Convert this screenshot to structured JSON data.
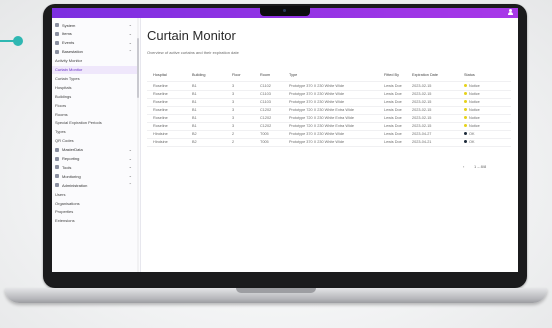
{
  "topbar": {
    "accent_start": "#7c2fe0",
    "accent_end": "#a838e8",
    "user_icon": "user-icon",
    "label": "ai"
  },
  "sidebar": {
    "items": [
      {
        "label": "System",
        "type": "group",
        "expanded": false
      },
      {
        "label": "Items",
        "type": "group",
        "expanded": false
      },
      {
        "label": "Events",
        "type": "group",
        "expanded": false
      },
      {
        "label": "Basestation",
        "type": "group",
        "expanded": true
      },
      {
        "label": "Activity Monitor",
        "type": "sub"
      },
      {
        "label": "Curtain Monitor",
        "type": "sub",
        "active": true
      },
      {
        "label": "Curtain Types",
        "type": "sub"
      },
      {
        "label": "Hospitals",
        "type": "sub"
      },
      {
        "label": "Buildings",
        "type": "sub"
      },
      {
        "label": "Floors",
        "type": "sub"
      },
      {
        "label": "Rooms",
        "type": "sub"
      },
      {
        "label": "Special Expiration Periods",
        "type": "sub"
      },
      {
        "label": "Types",
        "type": "sub"
      },
      {
        "label": "QR Codes",
        "type": "sub"
      },
      {
        "label": "MasterData",
        "type": "group",
        "expanded": false
      },
      {
        "label": "Reporting",
        "type": "group",
        "expanded": false
      },
      {
        "label": "Tools",
        "type": "group",
        "expanded": false
      },
      {
        "label": "Monitoring",
        "type": "group",
        "expanded": false
      },
      {
        "label": "Administration",
        "type": "group",
        "expanded": true
      },
      {
        "label": "Users",
        "type": "sub"
      },
      {
        "label": "Organisations",
        "type": "sub"
      },
      {
        "label": "Properties",
        "type": "sub"
      },
      {
        "label": "Extensions",
        "type": "sub"
      }
    ]
  },
  "main": {
    "title": "Curtain Monitor",
    "subtitle": "Overview of active curtains and their expiration date"
  },
  "table": {
    "columns": [
      "Hospital",
      "Building",
      "Floor",
      "Room",
      "Type",
      "Fitted By",
      "Expiration Date",
      "Status"
    ],
    "rows": [
      [
        "Roseline",
        "B1",
        "3",
        "C1102",
        "Prototype 370 X 230 White Wide",
        "Lewis Doe",
        "2023-02-15",
        "Notice"
      ],
      [
        "Roseline",
        "B1",
        "3",
        "C1103",
        "Prototype 370 X 230 White Wide",
        "Lewis Doe",
        "2023-02-15",
        "Notice"
      ],
      [
        "Roseline",
        "B1",
        "3",
        "C1103",
        "Prototype 370 X 230 White Wide",
        "Lewis Doe",
        "2023-02-15",
        "Notice"
      ],
      [
        "Roseline",
        "B1",
        "3",
        "C1202",
        "Prototype 720 X 230 White Extra Wide",
        "Lewis Doe",
        "2023-02-15",
        "Notice"
      ],
      [
        "Roseline",
        "B1",
        "3",
        "C1202",
        "Prototype 720 X 230 White Extra Wide",
        "Lewis Doe",
        "2023-02-15",
        "Notice"
      ],
      [
        "Roseline",
        "B1",
        "3",
        "C1202",
        "Prototype 720 X 230 White Extra Wide",
        "Lewis Doe",
        "2023-02-15",
        "Notice"
      ],
      [
        "Hindsine",
        "B2",
        "2",
        "T005",
        "Prototype 370 X 230 White Wide",
        "Lewis Doe",
        "2023-04-27",
        "OK"
      ],
      [
        "Hindsine",
        "B2",
        "2",
        "T005",
        "Prototype 370 X 230 White Wide",
        "Lewis Doe",
        "2023-04-21",
        "OK"
      ]
    ],
    "status_colors": {
      "Notice": "#e6d21a",
      "OK": "#1d2a3a"
    }
  },
  "pager": {
    "text": "1 – 8/8",
    "prev_icon": "chevron-left-icon",
    "next_icon": "chevron-right-icon"
  },
  "connector": {
    "color": "#2fb7b2"
  }
}
